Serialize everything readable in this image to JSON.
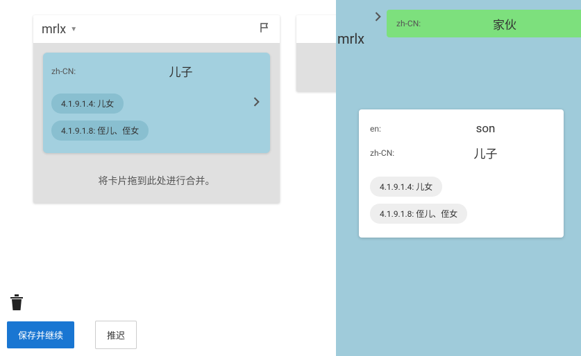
{
  "left": {
    "username": "mrlx",
    "card": {
      "lang_label": "zh-CN:",
      "value": "儿子",
      "chips": [
        "4.1.9.1.4: 儿女",
        "4.1.9.1.8: 侄儿、侄女"
      ]
    },
    "drop_hint": "将卡片拖到此处进行合并。"
  },
  "right": {
    "username": "mrlx",
    "green_card": {
      "lang_label": "zh-CN:",
      "value": "家伙"
    },
    "white_card": {
      "rows": [
        {
          "lang_label": "en:",
          "value": "son"
        },
        {
          "lang_label": "zh-CN:",
          "value": "儿子"
        }
      ],
      "chips": [
        "4.1.9.1.4: 儿女",
        "4.1.9.1.8: 侄儿、侄女"
      ]
    }
  },
  "buttons": {
    "save_continue": "保存并继续",
    "defer": "推迟"
  }
}
